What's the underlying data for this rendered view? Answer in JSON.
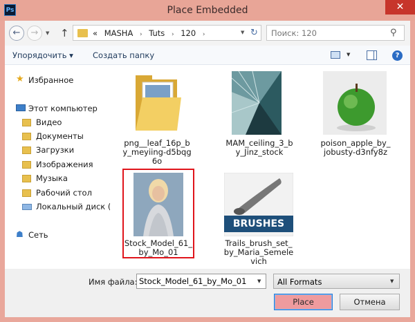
{
  "window": {
    "title": "Place Embedded",
    "app_icon_label": "Ps",
    "close_label": "✕"
  },
  "nav": {
    "back_label": "←",
    "forward_label": "→",
    "dropdown_label": "▼",
    "up_label": "↑",
    "breadcrumb_prefix": "«",
    "breadcrumb": [
      "MASHA",
      "Tuts",
      "120"
    ],
    "breadcrumb_sep": "›",
    "address_dropdown": "▼",
    "refresh_label": "↻",
    "search_placeholder": "Поиск: 120",
    "search_icon_glyph": "⚲"
  },
  "toolbar": {
    "organize_label": "Упорядочить ▾",
    "new_folder_label": "Создать папку",
    "view_dropdown": "▼",
    "help_label": "?"
  },
  "sidebar": {
    "favorites": "Избранное",
    "computer": "Этот компьютер",
    "items": [
      "Видео",
      "Документы",
      "Загрузки",
      "Изображения",
      "Музыка",
      "Рабочий стол",
      "Локальный диск (C"
    ],
    "network": "Сеть",
    "star_glyph": "★",
    "network_glyph": "☗"
  },
  "files": [
    {
      "label": "png__leaf_16p_b\ny_meyiing-d5bqg\n6o",
      "type": "folder"
    },
    {
      "label": "MAM_ceiling_3_b\ny_Jinz_stock",
      "type": "image"
    },
    {
      "label": "poison_apple_by_\njobusty-d3nfy8z",
      "type": "image"
    },
    {
      "label": "Stock_Model_61_\nby_Mo_01",
      "type": "image",
      "selected": true
    },
    {
      "label": "Trails_brush_set_\nby_Maria_Semele\nvich",
      "type": "brush",
      "badge": "BRUSHES"
    }
  ],
  "bottom": {
    "filename_label": "Имя файла:",
    "filename_value": "Stock_Model_61_by_Mo_01",
    "filename_dropdown": "▼",
    "format_value": "All Formats",
    "format_dropdown": "▼",
    "place_label": "Place",
    "cancel_label": "Отмена"
  }
}
